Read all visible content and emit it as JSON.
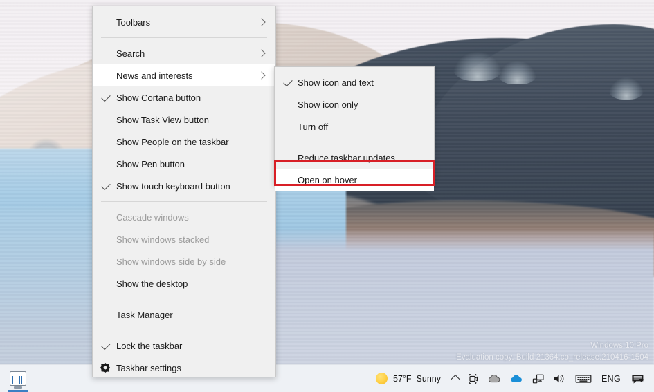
{
  "desktop": {
    "watermark_line1": "Windows 10 Pro",
    "watermark_line2": "Evaluation copy. Build 21364.co_release.210416-1504"
  },
  "taskbar": {
    "apps": [
      {
        "name": "task-manager",
        "label": "Task Manager",
        "active": true
      }
    ],
    "weather": {
      "icon": "sun-icon",
      "temperature": "57°F",
      "condition": "Sunny"
    },
    "tray": [
      {
        "name": "show-hidden-icons",
        "icon": "chevron-up-icon",
        "label": ""
      },
      {
        "name": "meet-now",
        "icon": "camera-icon",
        "label": ""
      },
      {
        "name": "onedrive-personal",
        "icon": "cloud-gray-icon",
        "label": ""
      },
      {
        "name": "onedrive-business",
        "icon": "cloud-blue-icon",
        "label": ""
      },
      {
        "name": "network",
        "icon": "network-icon",
        "label": ""
      },
      {
        "name": "volume",
        "icon": "speaker-icon",
        "label": ""
      },
      {
        "name": "touch-keyboard",
        "icon": "keyboard-icon",
        "label": ""
      },
      {
        "name": "language",
        "icon": "text-icon",
        "label": "ENG"
      },
      {
        "name": "action-center",
        "icon": "notification-icon",
        "label": ""
      }
    ]
  },
  "context_menu": {
    "items": [
      {
        "label": "Toolbars",
        "checked": false,
        "arrow": true,
        "disabled": false,
        "highlight": false,
        "icon": null,
        "sep_after": true
      },
      {
        "label": "Search",
        "checked": false,
        "arrow": true,
        "disabled": false,
        "highlight": false,
        "icon": null,
        "sep_after": false
      },
      {
        "label": "News and interests",
        "checked": false,
        "arrow": true,
        "disabled": false,
        "highlight": true,
        "icon": null,
        "sep_after": false
      },
      {
        "label": "Show Cortana button",
        "checked": true,
        "arrow": false,
        "disabled": false,
        "highlight": false,
        "icon": null,
        "sep_after": false
      },
      {
        "label": "Show Task View button",
        "checked": false,
        "arrow": false,
        "disabled": false,
        "highlight": false,
        "icon": null,
        "sep_after": false
      },
      {
        "label": "Show People on the taskbar",
        "checked": false,
        "arrow": false,
        "disabled": false,
        "highlight": false,
        "icon": null,
        "sep_after": false
      },
      {
        "label": "Show Pen button",
        "checked": false,
        "arrow": false,
        "disabled": false,
        "highlight": false,
        "icon": null,
        "sep_after": false
      },
      {
        "label": "Show touch keyboard button",
        "checked": true,
        "arrow": false,
        "disabled": false,
        "highlight": false,
        "icon": null,
        "sep_after": true
      },
      {
        "label": "Cascade windows",
        "checked": false,
        "arrow": false,
        "disabled": true,
        "highlight": false,
        "icon": null,
        "sep_after": false
      },
      {
        "label": "Show windows stacked",
        "checked": false,
        "arrow": false,
        "disabled": true,
        "highlight": false,
        "icon": null,
        "sep_after": false
      },
      {
        "label": "Show windows side by side",
        "checked": false,
        "arrow": false,
        "disabled": true,
        "highlight": false,
        "icon": null,
        "sep_after": false
      },
      {
        "label": "Show the desktop",
        "checked": false,
        "arrow": false,
        "disabled": false,
        "highlight": false,
        "icon": null,
        "sep_after": true
      },
      {
        "label": "Task Manager",
        "checked": false,
        "arrow": false,
        "disabled": false,
        "highlight": false,
        "icon": null,
        "sep_after": true
      },
      {
        "label": "Lock the taskbar",
        "checked": true,
        "arrow": false,
        "disabled": false,
        "highlight": false,
        "icon": null,
        "sep_after": false
      },
      {
        "label": "Taskbar settings",
        "checked": false,
        "arrow": false,
        "disabled": false,
        "highlight": false,
        "icon": "gear-icon",
        "sep_after": false
      }
    ]
  },
  "submenu": {
    "parent": "News and interests",
    "items": [
      {
        "label": "Show icon and text",
        "checked": true,
        "disabled": false,
        "highlight": false,
        "sep_after": false
      },
      {
        "label": "Show icon only",
        "checked": false,
        "disabled": false,
        "highlight": false,
        "sep_after": false
      },
      {
        "label": "Turn off",
        "checked": false,
        "disabled": false,
        "highlight": false,
        "sep_after": true
      },
      {
        "label": "Reduce taskbar updates",
        "checked": false,
        "disabled": false,
        "highlight": false,
        "sep_after": false
      },
      {
        "label": "Open on hover",
        "checked": false,
        "disabled": false,
        "highlight": true,
        "sep_after": false
      }
    ]
  },
  "annotation": {
    "type": "rectangle-highlight",
    "target": "Open on hover",
    "color": "#d81f26"
  }
}
